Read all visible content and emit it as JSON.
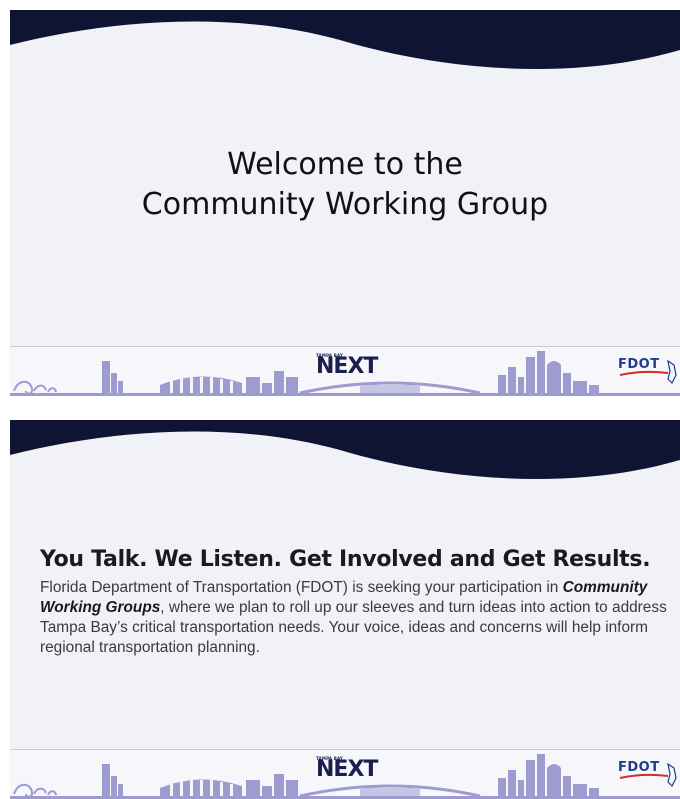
{
  "slides": [
    {
      "title_line1": "Welcome to the",
      "title_line2": "Community Working Group"
    },
    {
      "headline": "You Talk. We Listen. Get Involved and Get Results.",
      "body_part1": "Florida Department of Transportation (FDOT) is seeking your participation in ",
      "body_emphasis": "Community Working Groups",
      "body_part2": ", where we plan to roll up our sleeves and turn ideas into action to address Tampa Bay’s critical transportation needs. Your voice, ideas and concerns will help inform regional transportation planning."
    }
  ],
  "footer": {
    "next_logo_small": "TAMPA BAY",
    "next_logo_main": "NEXT",
    "fdot_logo": "FDOT"
  },
  "colors": {
    "wave": "#0f1433",
    "slide_bg": "#f1f1f8",
    "skyline": "#9e9bd0",
    "next_navy": "#1a1f4d",
    "fdot_blue": "#1f3d8a",
    "fdot_red": "#d62b2b"
  }
}
